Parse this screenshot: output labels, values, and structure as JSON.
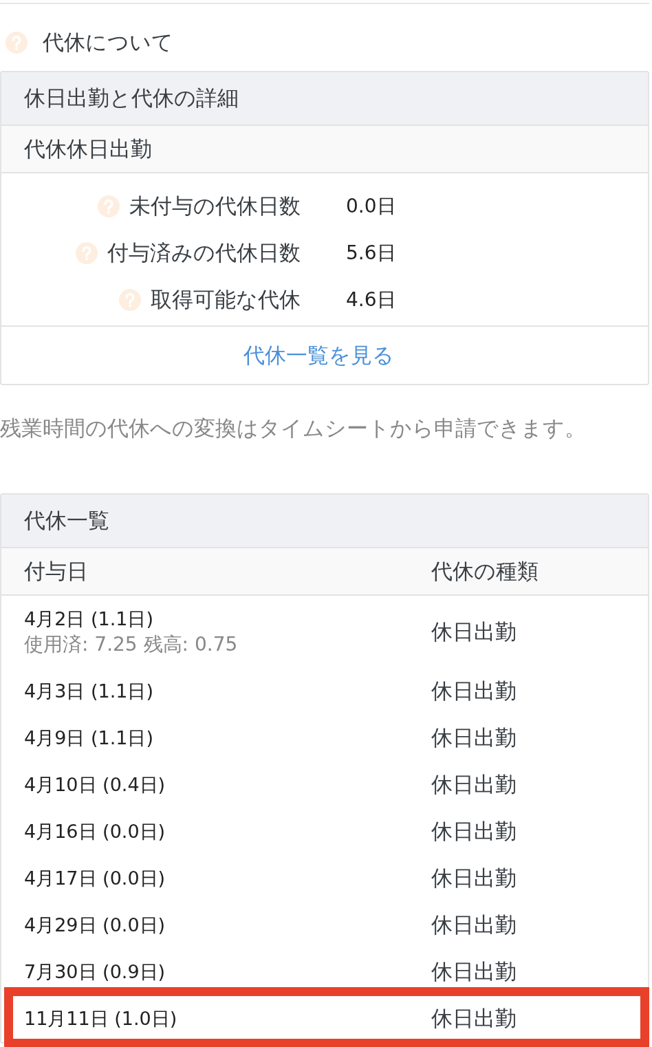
{
  "help_link": {
    "label": "代休について"
  },
  "detail_panel": {
    "title": "休日出勤と代休の詳細",
    "subtitle": "代休休日出勤",
    "stats": [
      {
        "label": "未付与の代休日数",
        "value": "0.0日"
      },
      {
        "label": "付与済みの代休日数",
        "value": "5.6日"
      },
      {
        "label": "取得可能な代休",
        "value": "4.6日"
      }
    ],
    "link": "代休一覧を見る"
  },
  "note": "残業時間の代休への変換はタイムシートから申請できます。",
  "list_panel": {
    "title": "代休一覧",
    "columns": [
      "付与日",
      "代休の種類"
    ],
    "rows": [
      {
        "date": "4月2日 (1.1日)",
        "usage": "使用済: 7.25 残高: 0.75",
        "type": "休日出勤",
        "highlighted": false
      },
      {
        "date": "4月3日 (1.1日)",
        "type": "休日出勤",
        "highlighted": false
      },
      {
        "date": "4月9日 (1.1日)",
        "type": "休日出勤",
        "highlighted": false
      },
      {
        "date": "4月10日 (0.4日)",
        "type": "休日出勤",
        "highlighted": false
      },
      {
        "date": "4月16日 (0.0日)",
        "type": "休日出勤",
        "highlighted": false
      },
      {
        "date": "4月17日 (0.0日)",
        "type": "休日出勤",
        "highlighted": false
      },
      {
        "date": "4月29日 (0.0日)",
        "type": "休日出勤",
        "highlighted": false
      },
      {
        "date": "7月30日 (0.9日)",
        "type": "休日出勤",
        "highlighted": false
      },
      {
        "date": "11月11日 (1.0日)",
        "type": "休日出勤",
        "highlighted": true
      }
    ]
  }
}
